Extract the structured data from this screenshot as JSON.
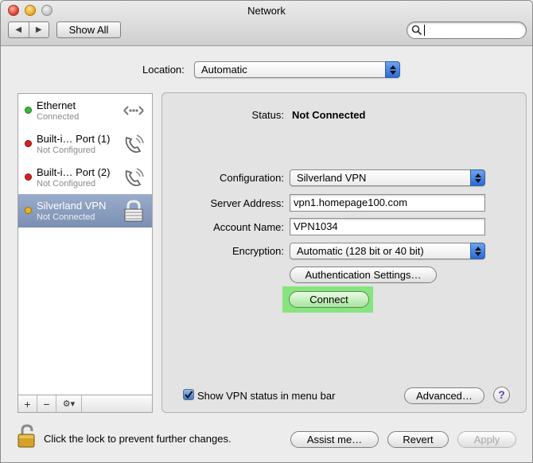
{
  "window": {
    "title": "Network"
  },
  "toolbar": {
    "back_label": "◀",
    "forward_label": "▶",
    "show_all_label": "Show All",
    "search_placeholder": ""
  },
  "location": {
    "label": "Location:",
    "value": "Automatic"
  },
  "services": [
    {
      "name": "Ethernet",
      "status": "Connected",
      "dot_color": "#38b83a",
      "icon": "ethernet-icon"
    },
    {
      "name": "Built-i… Port (1)",
      "status": "Not Configured",
      "dot_color": "#d62020",
      "icon": "phone-modem-icon"
    },
    {
      "name": "Built-i… Port (2)",
      "status": "Not Configured",
      "dot_color": "#d62020",
      "icon": "phone-modem-icon"
    },
    {
      "name": "Silverland VPN",
      "status": "Not Connected",
      "dot_color": "#f0b020",
      "icon": "vpn-lock-icon"
    }
  ],
  "list_buttons": {
    "add": "+",
    "remove": "−",
    "gear": "⚙▾"
  },
  "detail": {
    "status_label": "Status:",
    "status_value": "Not Connected",
    "configuration_label": "Configuration:",
    "configuration_value": "Silverland VPN",
    "server_label": "Server Address:",
    "server_value": "vpn1.homepage100.com",
    "account_label": "Account Name:",
    "account_value": "VPN1034",
    "encryption_label": "Encryption:",
    "encryption_value": "Automatic (128 bit or 40 bit)",
    "auth_button": "Authentication Settings…",
    "connect_button": "Connect",
    "show_vpn_label": "Show VPN status in menu bar",
    "show_vpn_checked": true,
    "advanced_button": "Advanced…",
    "help_label": "?"
  },
  "footer": {
    "lock_text": "Click the lock to prevent further changes.",
    "assist_button": "Assist me…",
    "revert_button": "Revert",
    "apply_button": "Apply"
  },
  "colors": {
    "selection": "#7a8fb3",
    "connect_highlight": "#87e47e",
    "popup_arrows": "#2a6ad8"
  }
}
